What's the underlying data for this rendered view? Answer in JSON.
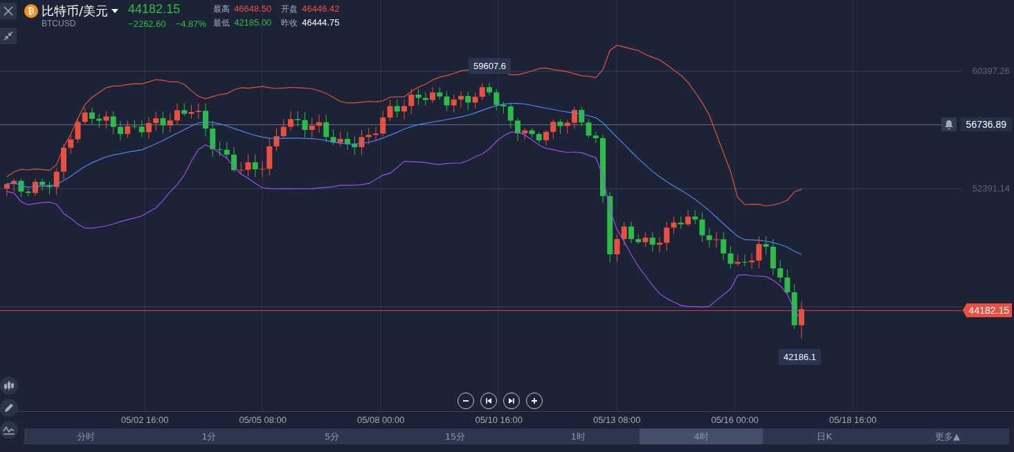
{
  "header": {
    "logo": "₿",
    "name": "比特币/美元",
    "code": "BTCUSD",
    "price": "44182.15",
    "change": "−2262.60",
    "change_pct": "−4.87%",
    "color": "#2dbb4a"
  },
  "stats": [
    {
      "label": "最高",
      "value": "46648.50",
      "color": "#e9503f"
    },
    {
      "label": "开盘",
      "value": "46446.42",
      "color": "#e9503f"
    },
    {
      "label": "最低",
      "value": "42185.00",
      "color": "#2dbb4a"
    },
    {
      "label": "昨收",
      "value": "46444.75",
      "color": "#ffffff"
    }
  ],
  "price_axis": {
    "labels": [
      "60397.26",
      "52391.14"
    ],
    "crosshair": "56736.89",
    "current": "44182.15"
  },
  "markers": {
    "high": "59607.6",
    "low": "42186.1"
  },
  "time_axis": [
    "05/02 16:00",
    "05/05 08:00",
    "05/08 00:00",
    "05/10 16:00",
    "05/13 08:00",
    "05/16 00:00",
    "05/18 16:00"
  ],
  "periods": [
    {
      "label": "分时",
      "selected": false
    },
    {
      "label": "1分",
      "selected": false
    },
    {
      "label": "5分",
      "selected": false
    },
    {
      "label": "15分",
      "selected": false
    },
    {
      "label": "1时",
      "selected": false
    },
    {
      "label": "4时",
      "selected": true
    },
    {
      "label": "日K",
      "selected": false
    },
    {
      "label": "更多▲",
      "selected": false
    }
  ]
}
